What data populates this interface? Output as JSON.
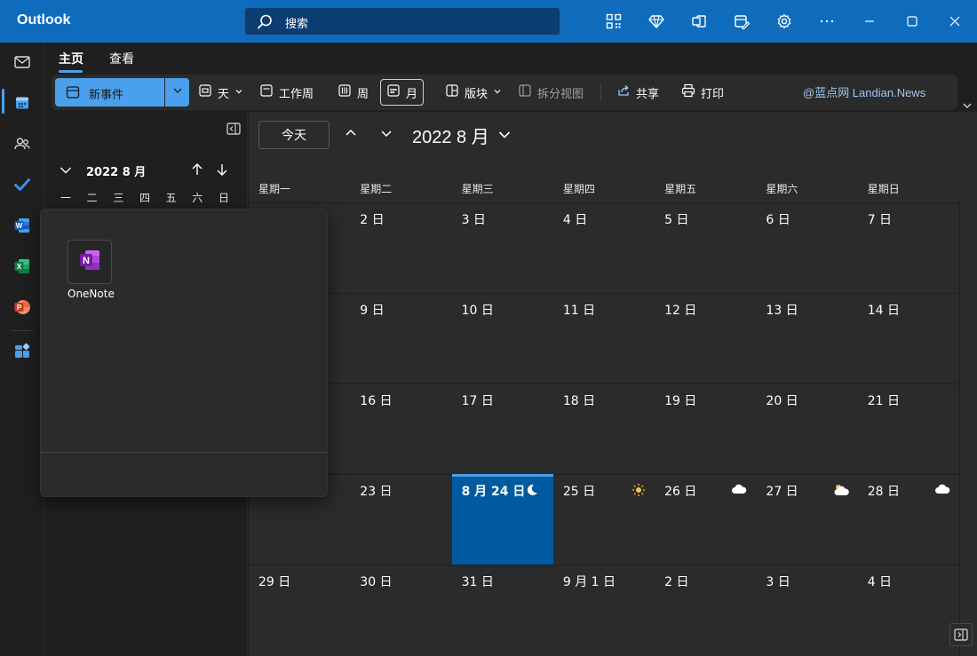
{
  "window": {
    "app_title": "Outlook"
  },
  "search": {
    "placeholder": "搜索"
  },
  "ribbon": {
    "tabs": [
      {
        "label": "主页"
      },
      {
        "label": "查看"
      }
    ],
    "new_event_label": "新事件",
    "tools": {
      "day": "天",
      "work_week": "工作周",
      "week": "周",
      "month": "月",
      "board": "版块",
      "split_view": "拆分视图",
      "share": "共享",
      "print": "打印"
    },
    "watermark": "@蓝点网 Landian.News"
  },
  "mini_calendar": {
    "title": "2022 8 月",
    "weekdays": [
      "一",
      "二",
      "三",
      "四",
      "五",
      "六",
      "日"
    ]
  },
  "launcher": {
    "apps": [
      {
        "name": "OneNote"
      }
    ]
  },
  "calendar": {
    "today_label": "今天",
    "month_title": "2022 8 月",
    "weekdays": [
      "星期一",
      "星期二",
      "星期三",
      "星期四",
      "星期五",
      "星期六",
      "星期日"
    ],
    "weeks": [
      [
        {
          "label": ""
        },
        {
          "label": "2 日"
        },
        {
          "label": "3 日"
        },
        {
          "label": "4 日"
        },
        {
          "label": "5 日"
        },
        {
          "label": "6 日"
        },
        {
          "label": "7 日"
        }
      ],
      [
        {
          "label": ""
        },
        {
          "label": "9 日"
        },
        {
          "label": "10 日"
        },
        {
          "label": "11 日"
        },
        {
          "label": "12 日"
        },
        {
          "label": "13 日"
        },
        {
          "label": "14 日"
        }
      ],
      [
        {
          "label": ""
        },
        {
          "label": "16 日"
        },
        {
          "label": "17 日"
        },
        {
          "label": "18 日"
        },
        {
          "label": "19 日"
        },
        {
          "label": "20 日"
        },
        {
          "label": "21 日"
        }
      ],
      [
        {
          "label": ""
        },
        {
          "label": "23 日"
        },
        {
          "label": "8 月 24 日",
          "today": true,
          "weather": "moon"
        },
        {
          "label": "25 日",
          "weather": "sun"
        },
        {
          "label": "26 日",
          "weather": "cloud"
        },
        {
          "label": "27 日",
          "weather": "partly-cloudy"
        },
        {
          "label": "28 日",
          "weather": "cloud"
        }
      ],
      [
        {
          "label": "29 日"
        },
        {
          "label": "30 日"
        },
        {
          "label": "31 日"
        },
        {
          "label": "9 月 1 日"
        },
        {
          "label": "2 日"
        },
        {
          "label": "3 日"
        },
        {
          "label": "4 日"
        }
      ]
    ]
  },
  "colors": {
    "titlebar": "#0f6cbd",
    "accent": "#4aa0ec",
    "today_cell": "#005aa0",
    "onenote": "#7719aa"
  }
}
